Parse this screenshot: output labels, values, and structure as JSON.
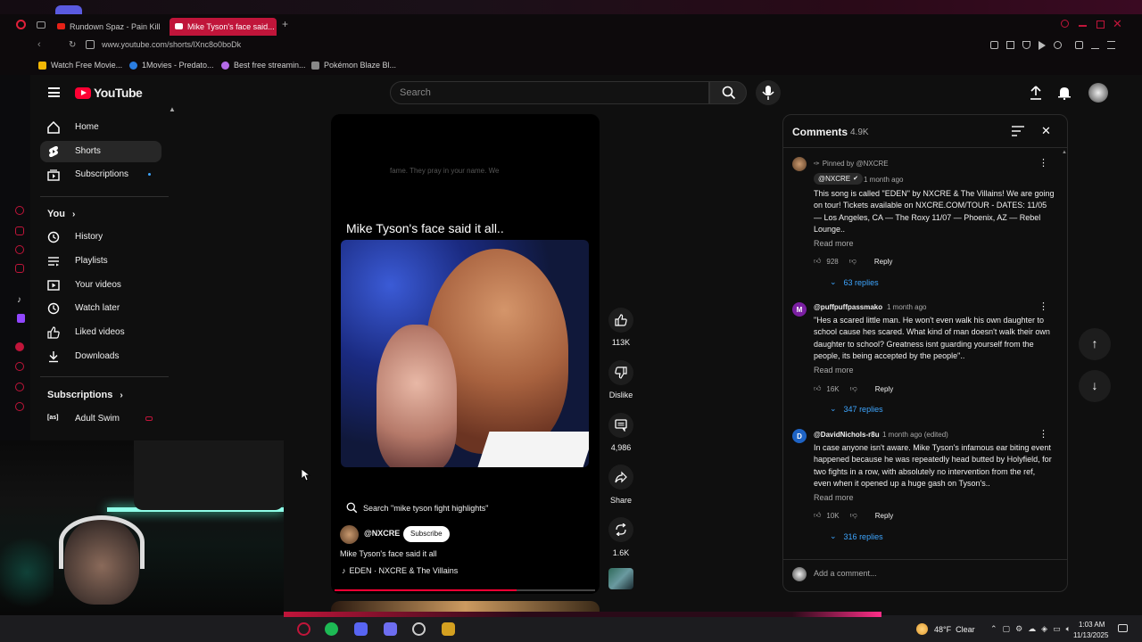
{
  "browser": {
    "tabs": [
      {
        "title": "Rundown Spaz - Pain Killa"
      },
      {
        "title": "Mike Tyson's face said..."
      }
    ],
    "url": "www.youtube.com/shorts/lXnc8o0boDk",
    "bookmarks": [
      "Watch Free Movie...",
      "1Movies - Predato...",
      "Best free streamin...",
      "Pokémon Blaze Bl..."
    ]
  },
  "youtube": {
    "logo_text": "YouTube",
    "search_placeholder": "Search",
    "sidebar": {
      "main": [
        {
          "label": "Home",
          "icon": "home-icon"
        },
        {
          "label": "Shorts",
          "icon": "shorts-icon"
        },
        {
          "label": "Subscriptions",
          "icon": "subscriptions-icon"
        }
      ],
      "you_header": "You",
      "you": [
        {
          "label": "History",
          "icon": "history-icon"
        },
        {
          "label": "Playlists",
          "icon": "playlists-icon"
        },
        {
          "label": "Your videos",
          "icon": "your-videos-icon"
        },
        {
          "label": "Watch later",
          "icon": "clock-icon"
        },
        {
          "label": "Liked videos",
          "icon": "thumbs-up-icon"
        },
        {
          "label": "Downloads",
          "icon": "download-icon"
        }
      ],
      "subs_header": "Subscriptions",
      "subs": [
        {
          "label": "Adult Swim"
        }
      ]
    },
    "short": {
      "caption_text": "fame. They pray in your name. We",
      "title_overlay": "Mike Tyson's face said it all..",
      "search_suggestion": "Search \"mike tyson fight highlights\"",
      "channel": "@NXCRE",
      "subscribe_label": "Subscribe",
      "video_title": "Mike Tyson's face said it all",
      "song": "EDEN · NXCRE & The Villains",
      "progress": 0.7
    },
    "actions": {
      "likes": "113K",
      "dislike": "Dislike",
      "comments": "4,986",
      "share": "Share",
      "remix": "1.6K"
    },
    "comments_panel": {
      "title": "Comments",
      "count": "4.9K",
      "add_placeholder": "Add a comment...",
      "items": [
        {
          "pinned_label": "Pinned by @NXCRE",
          "author": "@NXCRE",
          "time": "1 month ago",
          "text": "This song is called \"EDEN\" by NXCRE & The Villains! We are going on tour! Tickets available on NXCRE.COM/TOUR - DATES: 11/05 — Los Angeles, CA — The Roxy 11/07 — Phoenix, AZ — Rebel Lounge..",
          "read_more": "Read more",
          "likes": "928",
          "reply_label": "Reply",
          "replies": "63 replies"
        },
        {
          "author": "@puffpuffpassmako",
          "time": "1 month ago",
          "text": "\"Hes a scared little man. He won't even walk his own daughter to school cause hes scared. What kind of man doesn't walk their own daughter to school? Greatness isnt guarding yourself from the people, its being accepted by the people\"..",
          "read_more": "Read more",
          "likes": "16K",
          "reply_label": "Reply",
          "replies": "347 replies",
          "avatar_letter": "M"
        },
        {
          "author": "@DavidNichols-r8u",
          "time": "1 month ago (edited)",
          "text": "In case anyone isn't aware. Mike Tyson's infamous ear biting event happened because he was repeatedly head butted by Holyfield, for two fights in a row, with absolutely no intervention from the ref, even when it opened up a huge gash on Tyson's..",
          "read_more": "Read more",
          "likes": "10K",
          "reply_label": "Reply",
          "replies": "316 replies",
          "avatar_letter": "D"
        }
      ]
    }
  },
  "taskbar": {
    "weather": "48°F  Clear",
    "time": "1:03 AM",
    "date": "11/13/2025"
  },
  "colors": {
    "accent": "#c0153a",
    "youtube_red": "#ff0033",
    "link_blue": "#3ea6ff"
  }
}
